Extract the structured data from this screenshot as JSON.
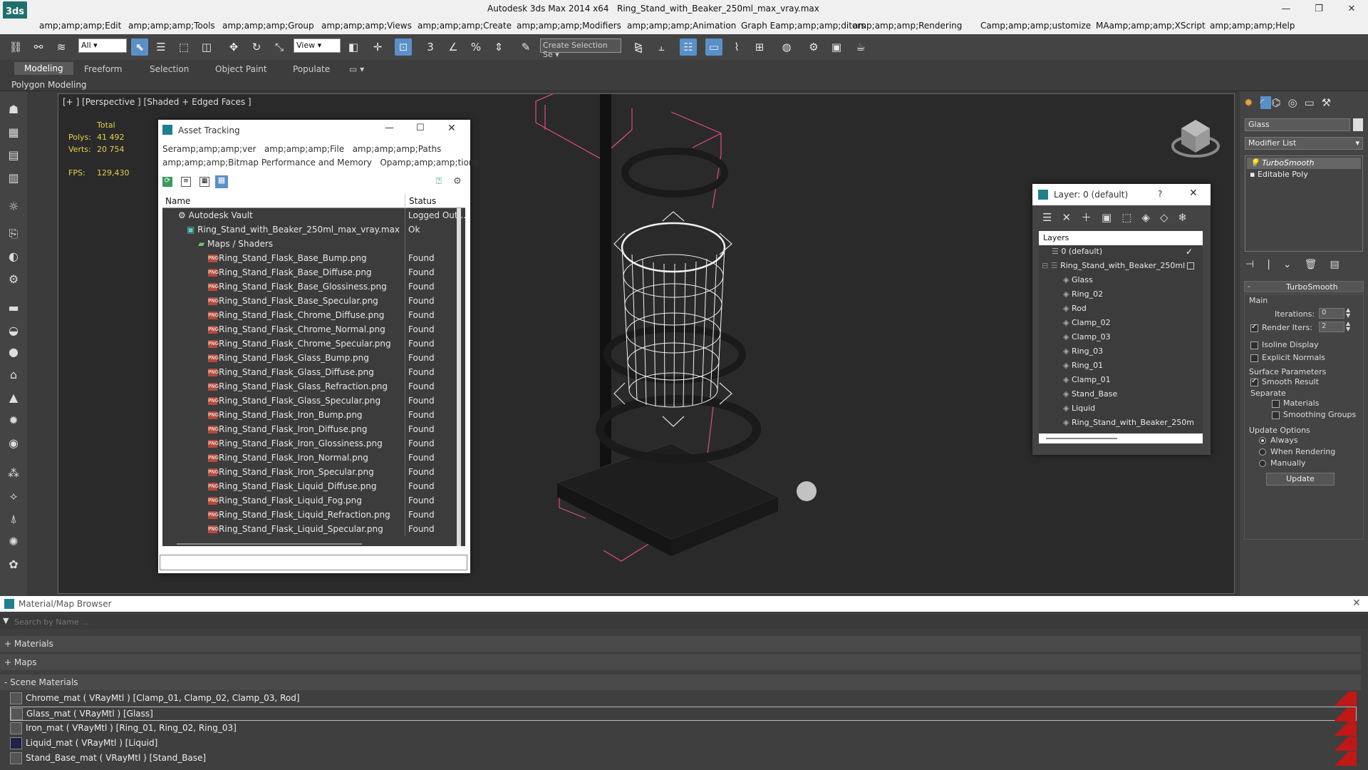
{
  "app": {
    "title": "Autodesk 3ds Max  2014 x64",
    "file": "Ring_Stand_with_Beaker_250ml_max_vray.max",
    "logo": "3ds"
  },
  "menu": [
    "amp;amp;amp;Edit",
    "amp;amp;amp;Tools",
    "amp;amp;amp;Group",
    "amp;amp;amp;Views",
    "amp;amp;amp;Create",
    "amp;amp;amp;Modifiers",
    "amp;amp;amp;Animation",
    "Graph Eamp;amp;amp;ditors",
    "amp;amp;amp;Rendering",
    "Camp;amp;amp;ustomize",
    "MAamp;amp;amp;XScript",
    "amp;amp;amp;Help"
  ],
  "toolbar": {
    "filter": "All",
    "view": "View",
    "selection_set": "Create Selection Se"
  },
  "ribbon": {
    "tabs": [
      "Modeling",
      "Freeform",
      "Selection",
      "Object Paint",
      "Populate"
    ],
    "sub": "Polygon Modeling"
  },
  "viewport": {
    "label": "[+ ] [Perspective ] [Shaded + Edged Faces ]",
    "total_label": "Total",
    "polys_label": "Polys:",
    "polys": "41 492",
    "verts_label": "Verts:",
    "verts": "20 754",
    "fps_label": "FPS:",
    "fps": "129,430"
  },
  "asset_tracking": {
    "title": "Asset Tracking",
    "menu1": [
      "Seramp;amp;amp;ver",
      "amp;amp;amp;File",
      "amp;amp;amp;Paths"
    ],
    "menu2": [
      "amp;amp;amp;Bitmap Performance and Memory",
      "Opamp;amp;amp;tions"
    ],
    "col_name": "Name",
    "col_status": "Status",
    "rows": [
      {
        "name": "Autodesk Vault",
        "status": "Logged Out ..."
      },
      {
        "name": "Ring_Stand_with_Beaker_250ml_max_vray.max",
        "status": "Ok"
      },
      {
        "name": "Maps / Shaders",
        "status": ""
      },
      {
        "name": "Ring_Stand_Flask_Base_Bump.png",
        "status": "Found"
      },
      {
        "name": "Ring_Stand_Flask_Base_Diffuse.png",
        "status": "Found"
      },
      {
        "name": "Ring_Stand_Flask_Base_Glossiness.png",
        "status": "Found"
      },
      {
        "name": "Ring_Stand_Flask_Base_Specular.png",
        "status": "Found"
      },
      {
        "name": "Ring_Stand_Flask_Chrome_Diffuse.png",
        "status": "Found"
      },
      {
        "name": "Ring_Stand_Flask_Chrome_Normal.png",
        "status": "Found"
      },
      {
        "name": "Ring_Stand_Flask_Chrome_Specular.png",
        "status": "Found"
      },
      {
        "name": "Ring_Stand_Flask_Glass_Bump.png",
        "status": "Found"
      },
      {
        "name": "Ring_Stand_Flask_Glass_Diffuse.png",
        "status": "Found"
      },
      {
        "name": "Ring_Stand_Flask_Glass_Refraction.png",
        "status": "Found"
      },
      {
        "name": "Ring_Stand_Flask_Glass_Specular.png",
        "status": "Found"
      },
      {
        "name": "Ring_Stand_Flask_Iron_Bump.png",
        "status": "Found"
      },
      {
        "name": "Ring_Stand_Flask_Iron_Diffuse.png",
        "status": "Found"
      },
      {
        "name": "Ring_Stand_Flask_Iron_Glossiness.png",
        "status": "Found"
      },
      {
        "name": "Ring_Stand_Flask_Iron_Normal.png",
        "status": "Found"
      },
      {
        "name": "Ring_Stand_Flask_Iron_Specular.png",
        "status": "Found"
      },
      {
        "name": "Ring_Stand_Flask_Liquid_Diffuse.png",
        "status": "Found"
      },
      {
        "name": "Ring_Stand_Flask_Liquid_Fog.png",
        "status": "Found"
      },
      {
        "name": "Ring_Stand_Flask_Liquid_Refraction.png",
        "status": "Found"
      },
      {
        "name": "Ring_Stand_Flask_Liquid_Specular.png",
        "status": "Found"
      }
    ]
  },
  "layers": {
    "title": "Layer: 0 (default)",
    "help": "?",
    "header": "Layers",
    "items": [
      "0 (default)",
      "Ring_Stand_with_Beaker_250ml",
      "Glass",
      "Ring_02",
      "Rod",
      "Clamp_02",
      "Clamp_03",
      "Ring_03",
      "Ring_01",
      "Clamp_01",
      "Stand_Base",
      "Liquid",
      "Ring_Stand_with_Beaker_250m"
    ]
  },
  "command_panel": {
    "object_name": "Glass",
    "modifier_list": "Modifier List",
    "stack": [
      "TurboSmooth",
      "Editable Poly"
    ],
    "rollout": "TurboSmooth",
    "main": "Main",
    "iterations_label": "Iterations:",
    "iterations": "0",
    "render_iters_label": "Render Iters:",
    "render_iters": "2",
    "isoline": "Isoline Display",
    "explicit": "Explicit Normals",
    "surface": "Surface Parameters",
    "smooth": "Smooth Result",
    "separate": "Separate",
    "materials": "Materials",
    "smoothing": "Smoothing Groups",
    "update_options": "Update Options",
    "always": "Always",
    "when_rendering": "When Rendering",
    "manually": "Manually",
    "update": "Update"
  },
  "material_browser": {
    "title": "Material/Map Browser",
    "search_placeholder": "Search by Name ...",
    "sections": [
      "+ Materials",
      "+ Maps",
      "- Scene Materials"
    ],
    "materials": [
      "Chrome_mat  ( VRayMtl ) [Clamp_01, Clamp_02, Clamp_03, Rod]",
      "Glass_mat  ( VRayMtl ) [Glass]",
      "Iron_mat  ( VRayMtl ) [Ring_01, Ring_02, Ring_03]",
      "Liquid_mat  ( VRayMtl ) [Liquid]",
      "Stand_Base_mat  ( VRayMtl ) [Stand_Base]"
    ]
  }
}
